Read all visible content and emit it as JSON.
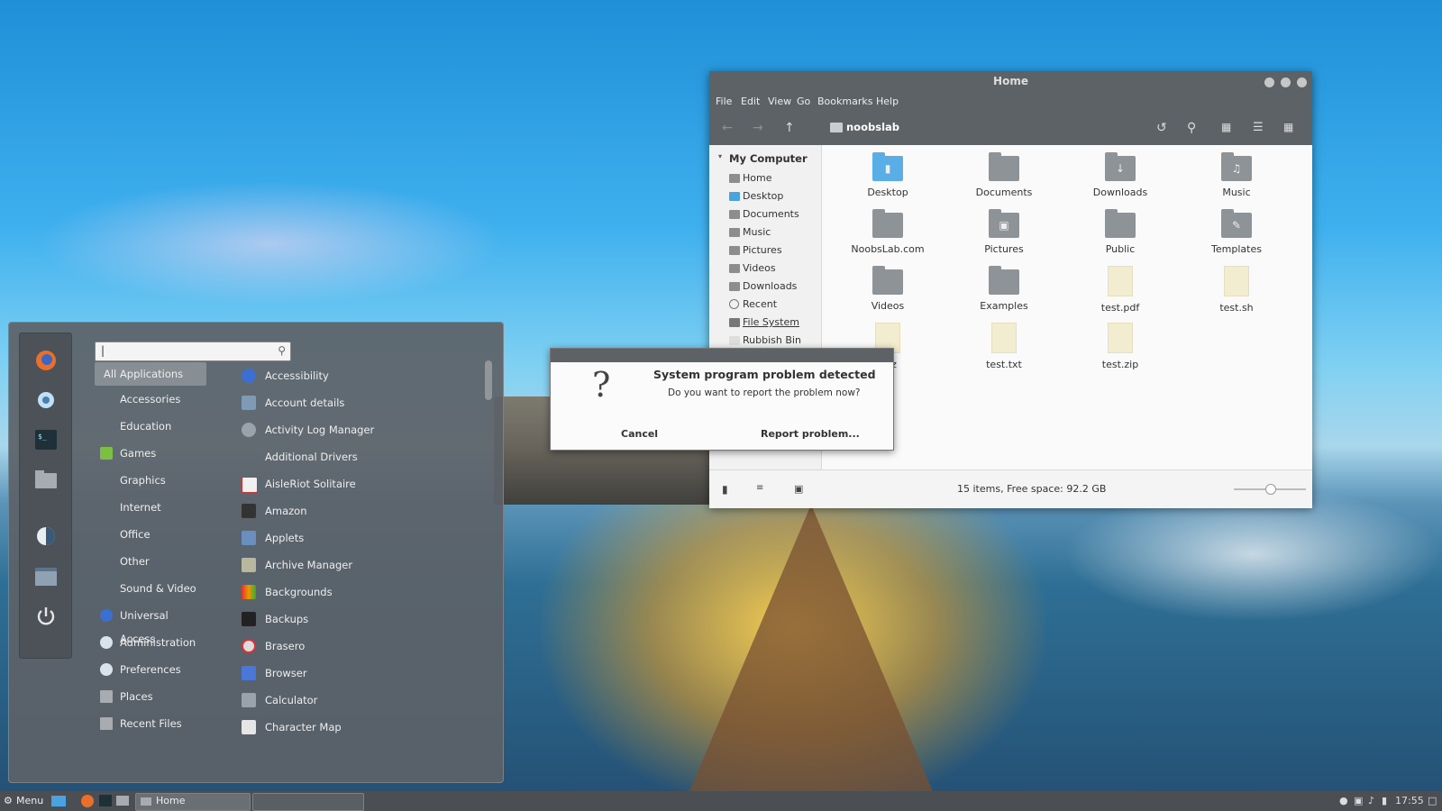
{
  "start_menu": {
    "search": {
      "value": "|"
    },
    "favorites": [
      "firefox-icon",
      "settings-icon",
      "terminal-icon",
      "files-icon",
      "display-icon",
      "window-icon",
      "power-icon"
    ],
    "categories": [
      {
        "label": "All Applications",
        "selected": true
      },
      {
        "label": "Accessories"
      },
      {
        "label": "Education"
      },
      {
        "label": "Games"
      },
      {
        "label": "Graphics"
      },
      {
        "label": "Internet"
      },
      {
        "label": "Office"
      },
      {
        "label": "Other"
      },
      {
        "label": "Sound & Video"
      },
      {
        "label": "Universal Access"
      },
      {
        "label": "Administration"
      },
      {
        "label": "Preferences"
      },
      {
        "label": "Places"
      },
      {
        "label": "Recent Files"
      }
    ],
    "apps": [
      {
        "label": "Accessibility"
      },
      {
        "label": "Account details"
      },
      {
        "label": "Activity Log Manager"
      },
      {
        "label": "Additional Drivers"
      },
      {
        "label": "AisleRiot Solitaire"
      },
      {
        "label": "Amazon"
      },
      {
        "label": "Applets"
      },
      {
        "label": "Archive Manager"
      },
      {
        "label": "Backgrounds"
      },
      {
        "label": "Backups"
      },
      {
        "label": "Brasero"
      },
      {
        "label": "Browser"
      },
      {
        "label": "Calculator"
      },
      {
        "label": "Character Map"
      }
    ]
  },
  "file_manager": {
    "title": "Home",
    "menu": [
      "File",
      "Edit",
      "View",
      "Go",
      "Bookmarks",
      "Help"
    ],
    "path": "noobslab",
    "sidebar": {
      "heading": "My Computer",
      "items": [
        "Home",
        "Desktop",
        "Documents",
        "Music",
        "Pictures",
        "Videos",
        "Downloads",
        "Recent",
        "File System",
        "Rubbish Bin"
      ]
    },
    "files": [
      {
        "label": "Desktop",
        "kind": "folder-blue"
      },
      {
        "label": "Documents",
        "kind": "folder"
      },
      {
        "label": "Downloads",
        "kind": "folder"
      },
      {
        "label": "Music",
        "kind": "folder"
      },
      {
        "label": "NoobsLab.com",
        "kind": "folder"
      },
      {
        "label": "Pictures",
        "kind": "folder"
      },
      {
        "label": "Public",
        "kind": "folder"
      },
      {
        "label": "Templates",
        "kind": "folder"
      },
      {
        "label": "Videos",
        "kind": "folder"
      },
      {
        "label": "Examples",
        "kind": "folder"
      },
      {
        "label": "test.pdf",
        "kind": "doc"
      },
      {
        "label": "test.sh",
        "kind": "doc"
      },
      {
        "label": "r.gz",
        "kind": "doc"
      },
      {
        "label": "test.txt",
        "kind": "doc"
      },
      {
        "label": "test.zip",
        "kind": "doc"
      }
    ],
    "status": "15 items, Free space: 92.2 GB"
  },
  "dialog": {
    "title": "System program problem detected",
    "message": "Do you want to report the problem now?",
    "cancel_label": "Cancel",
    "report_label": "Report problem..."
  },
  "taskbar": {
    "menu_label": "Menu",
    "window_label": "Home",
    "clock": "17:55"
  }
}
